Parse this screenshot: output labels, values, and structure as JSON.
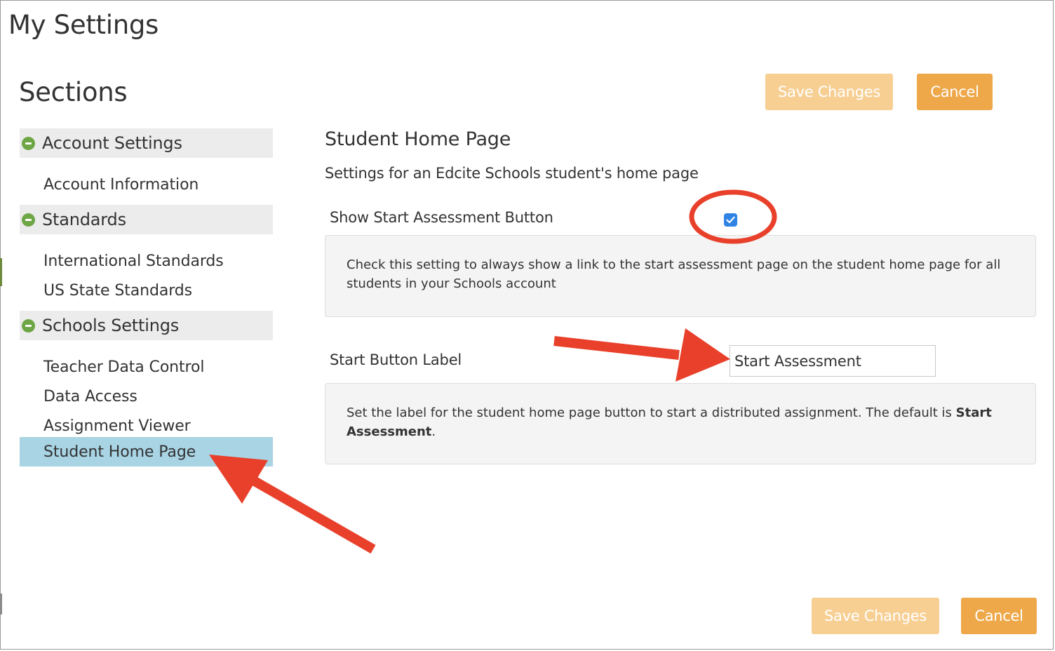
{
  "window": {
    "title": "My Settings"
  },
  "sidebar": {
    "heading": "Sections",
    "groups": [
      {
        "label": "Account Settings",
        "items": [
          "Account Information"
        ]
      },
      {
        "label": "Standards",
        "items": [
          "International Standards",
          "US State Standards"
        ]
      },
      {
        "label": "Schools Settings",
        "items": [
          "Teacher Data Control",
          "Data Access",
          "Assignment Viewer",
          "Student Home Page"
        ]
      }
    ],
    "active_item": "Student Home Page"
  },
  "toolbar": {
    "save_label": "Save Changes",
    "cancel_label": "Cancel"
  },
  "footer": {
    "save_label": "Save Changes",
    "cancel_label": "Cancel"
  },
  "pane": {
    "title": "Student Home Page",
    "subtitle": "Settings for an Edcite Schools student's home page",
    "show_start": {
      "label": "Show Start Assessment Button",
      "checked": true,
      "help": "Check this setting to always show a link to the start assessment page on the student home page for all students in your Schools account"
    },
    "start_label": {
      "label": "Start Button Label",
      "value": "Start Assessment",
      "help_prefix": "Set the label for the student home page button to start a distributed assignment. The default is ",
      "help_bold": "Start Assessment",
      "help_suffix": "."
    }
  },
  "annotations": {
    "color": "#e8402a",
    "shapes": [
      "circle-around-checkbox",
      "arrow-to-start-label-input",
      "arrow-to-student-home-page-item"
    ]
  },
  "colors": {
    "accent_orange": "#eea84a",
    "disabled_orange": "#f7cf93",
    "active_blue": "#a8d4e4",
    "group_green": "#6ea646",
    "checkbox_blue": "#2f83e4"
  }
}
